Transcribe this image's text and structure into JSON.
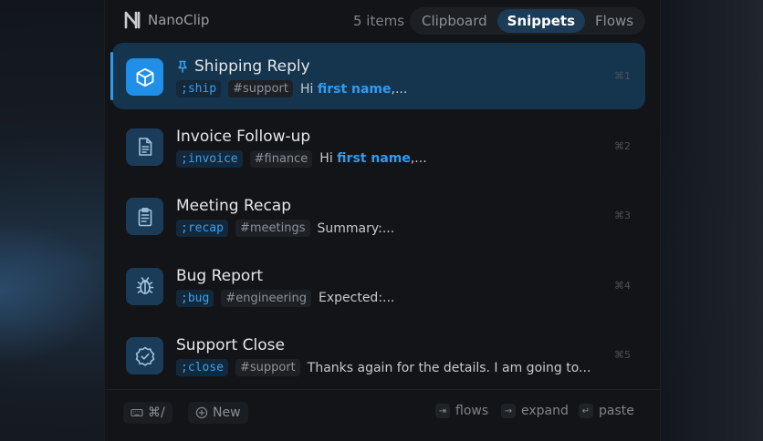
{
  "app": {
    "name": "NanoClip",
    "logo_icon": "nanoclip-logo-icon"
  },
  "header": {
    "count_label": "5 items",
    "tabs": [
      {
        "label": "Clipboard",
        "active": false
      },
      {
        "label": "Snippets",
        "active": true
      },
      {
        "label": "Flows",
        "active": false
      }
    ]
  },
  "snippets": [
    {
      "title": "Shipping Reply",
      "pinned": true,
      "icon": "box-icon",
      "trigger": ";ship",
      "tag": "#support",
      "preview_prefix": "Hi ",
      "preview_var": "first name",
      "preview_suffix": ",...",
      "shortcut": "⌘1",
      "selected": true
    },
    {
      "title": "Invoice Follow-up",
      "pinned": false,
      "icon": "document-icon",
      "trigger": ";invoice",
      "tag": "#finance",
      "preview_prefix": "Hi ",
      "preview_var": "first name",
      "preview_suffix": ",...",
      "shortcut": "⌘2",
      "selected": false
    },
    {
      "title": "Meeting Recap",
      "pinned": false,
      "icon": "clipboard-list-icon",
      "trigger": ";recap",
      "tag": "#meetings",
      "preview_prefix": "Summary:...",
      "preview_var": "",
      "preview_suffix": "",
      "shortcut": "⌘3",
      "selected": false
    },
    {
      "title": "Bug Report",
      "pinned": false,
      "icon": "bug-icon",
      "trigger": ";bug",
      "tag": "#engineering",
      "preview_prefix": "Expected:...",
      "preview_var": "",
      "preview_suffix": "",
      "shortcut": "⌘4",
      "selected": false
    },
    {
      "title": "Support Close",
      "pinned": false,
      "icon": "badge-check-icon",
      "trigger": ";close",
      "tag": "#support",
      "preview_prefix": "Thanks again for the details. I am going to...",
      "preview_var": "",
      "preview_suffix": "",
      "shortcut": "⌘5",
      "selected": false
    }
  ],
  "footer": {
    "keyboard_button_label": "⌘/",
    "new_button_label": "New",
    "hints": [
      {
        "key": "⇥",
        "label": "flows"
      },
      {
        "key": "→",
        "label": "expand"
      },
      {
        "key": "↵",
        "label": "paste"
      }
    ]
  },
  "colors": {
    "accent": "#2e9cf0",
    "selected_row": "#15354f",
    "panel_bg": "#121418"
  }
}
